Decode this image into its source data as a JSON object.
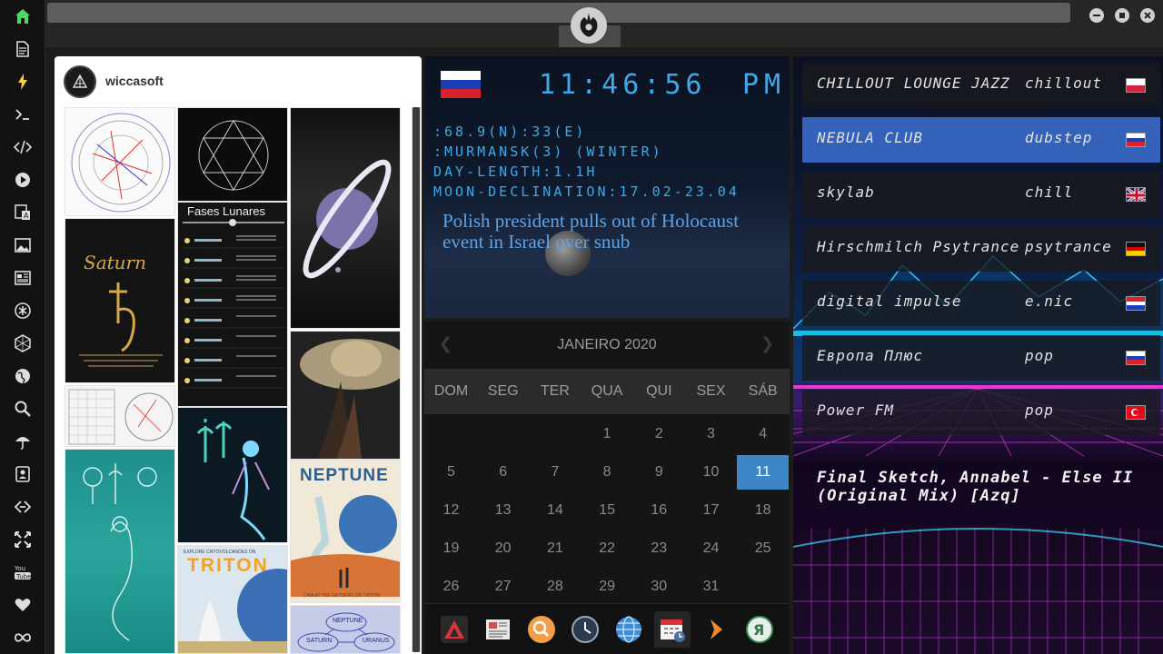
{
  "dock": {
    "items": [
      {
        "name": "home-icon",
        "color": "#4cd964"
      },
      {
        "name": "document-icon",
        "color": "#dddddd"
      },
      {
        "name": "lightning-icon",
        "color": "#f5d13d"
      },
      {
        "name": "terminal-icon",
        "color": "#dddddd"
      },
      {
        "name": "code-icon",
        "color": "#dddddd"
      },
      {
        "name": "play-icon",
        "color": "#dddddd"
      },
      {
        "name": "translate-icon",
        "color": "#dddddd"
      },
      {
        "name": "image-icon",
        "color": "#dddddd"
      },
      {
        "name": "newspaper-icon",
        "color": "#dddddd"
      },
      {
        "name": "asterisk-icon",
        "color": "#dddddd"
      },
      {
        "name": "hexagon-icon",
        "color": "#dddddd"
      },
      {
        "name": "globe-icon",
        "color": "#dddddd"
      },
      {
        "name": "search-icon",
        "color": "#dddddd"
      },
      {
        "name": "umbrella-icon",
        "color": "#dddddd"
      },
      {
        "name": "contact-icon",
        "color": "#dddddd"
      },
      {
        "name": "link-icon",
        "color": "#dddddd"
      },
      {
        "name": "fullscreen-icon",
        "color": "#dddddd"
      },
      {
        "name": "youtube-icon",
        "color": "#dddddd"
      },
      {
        "name": "heart-icon",
        "color": "#dddddd"
      },
      {
        "name": "infinity-icon",
        "color": "#dddddd"
      }
    ]
  },
  "pinterest": {
    "username": "wiccasoft",
    "pins": {
      "saturn_text": "Saturn",
      "fases_title": "Fases Lunares",
      "neptune_title": "NEPTUNE",
      "triton_title": "TRITON",
      "triton_sub": "EXPLORE CRYOVOLCANOES ON",
      "neptune_sub": "CAIA AT THE GEYSERS ON TRITON",
      "diagram_nodes": [
        "NEPTUNE",
        "SATURN",
        "URANUS"
      ]
    }
  },
  "clock": {
    "time": "11:46:56",
    "ampm": "PM",
    "lines": [
      ":68.9(N):33(E)",
      ":MURMANSK(3) (WINTER)",
      "DAY-LENGTH:1.1H",
      "MOON-DECLINATION:17.02-23.04"
    ],
    "headline": "Polish president pulls out of Holocaust event in Israel over snub",
    "flag_country": "Russia"
  },
  "calendar": {
    "month": "JANEIRO 2020",
    "weekdays": [
      "DOM",
      "SEG",
      "TER",
      "QUA",
      "QUI",
      "SEX",
      "SÁB"
    ],
    "first_weekday_index": 3,
    "days_in_month": 31,
    "today": 11,
    "accent": "#3d86c6"
  },
  "taskbar": {
    "items": [
      "app-store-icon",
      "news-app-icon",
      "search-app-icon",
      "clock-app-icon",
      "browser-globe-icon",
      "calendar-app-icon",
      "play-arrow-icon",
      "yandex-icon"
    ],
    "active_index": 5
  },
  "radio": {
    "stations": [
      {
        "name": "CHILLOUT LOUNGE JAZZ",
        "genre": "chillout",
        "flag": "poland"
      },
      {
        "name": "NEBULA CLUB",
        "genre": "dubstep",
        "flag": "russia"
      },
      {
        "name": "skylab",
        "genre": "chill",
        "flag": "uk"
      },
      {
        "name": "Hirschmilch Psytrance",
        "genre": "psytrance",
        "flag": "germany"
      },
      {
        "name": "digital impulse",
        "genre": "e.nic",
        "flag": "croatia"
      },
      {
        "name": "Европа Плюс",
        "genre": "pop",
        "flag": "russia"
      },
      {
        "name": "Power FM",
        "genre": "pop",
        "flag": "turkey"
      }
    ],
    "selected_index": 1,
    "now_playing": "Final Sketch, Annabel - Else II (Original Mix) [Azq]"
  }
}
